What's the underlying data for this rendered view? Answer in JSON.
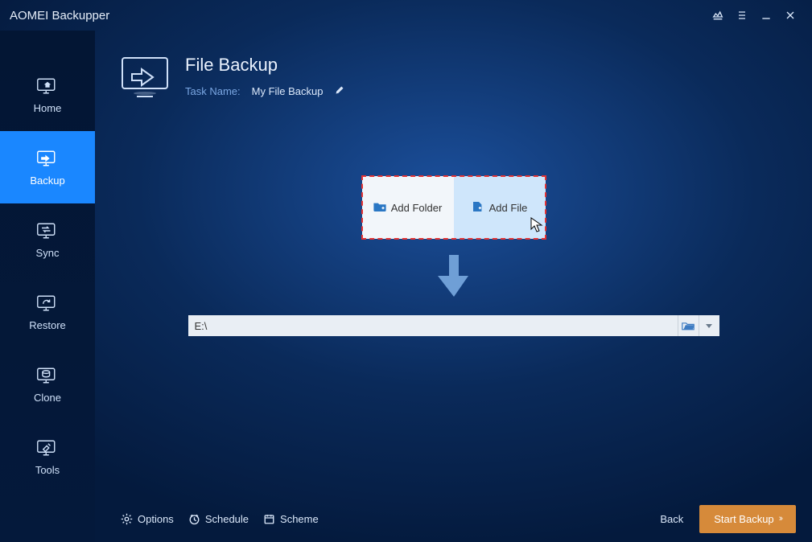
{
  "app": {
    "title": "AOMEI Backupper"
  },
  "sidebar": {
    "items": [
      {
        "label": "Home"
      },
      {
        "label": "Backup"
      },
      {
        "label": "Sync"
      },
      {
        "label": "Restore"
      },
      {
        "label": "Clone"
      },
      {
        "label": "Tools"
      }
    ],
    "active_index": 1
  },
  "page": {
    "title": "File Backup",
    "task_name_label": "Task Name:",
    "task_name_value": "My File Backup"
  },
  "add_buttons": {
    "folder": "Add Folder",
    "file": "Add File"
  },
  "destination": {
    "path": "E:\\"
  },
  "footer": {
    "options": "Options",
    "schedule": "Schedule",
    "scheme": "Scheme",
    "back": "Back",
    "start": "Start Backup"
  }
}
